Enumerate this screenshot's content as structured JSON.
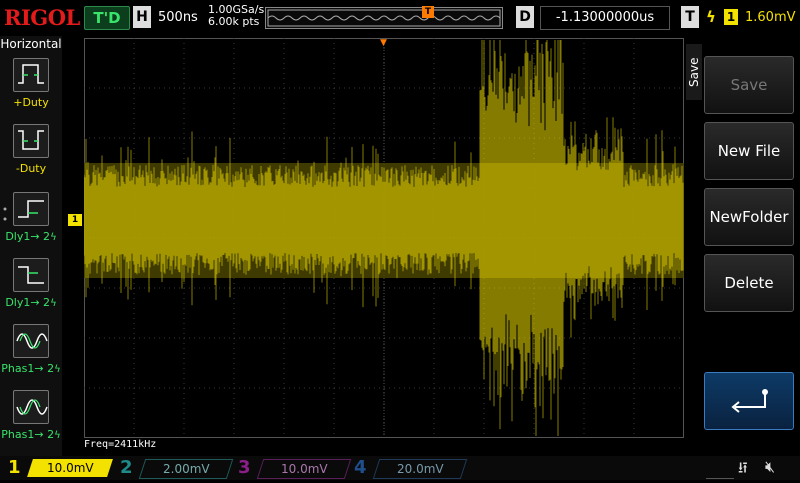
{
  "brand": "RIGOL",
  "header": {
    "run_state": "T'D",
    "horizontal_tag": "H",
    "timebase": "500ns",
    "sample_rate": "1.00GSa/s",
    "memory_depth": "6.00k pts",
    "trigger_position_marker": "T",
    "delay_tag": "D",
    "delay_value": "-1.13000000us",
    "trigger_tag": "T",
    "trigger_source": "1",
    "trigger_level": "1.60mV"
  },
  "left_menu": {
    "title": "Horizontal",
    "items": [
      {
        "label": "+Duty",
        "icon": "positive-duty-icon"
      },
      {
        "label": "-Duty",
        "icon": "negative-duty-icon"
      },
      {
        "label": "Dly1→ 2",
        "icon": "delay-rise-icon"
      },
      {
        "label": "Dly1→ 2",
        "icon": "delay-fall-icon"
      },
      {
        "label": "Phas1→ 2",
        "icon": "phase-rise-icon"
      },
      {
        "label": "Phas1→ 2",
        "icon": "phase-fall-icon"
      }
    ]
  },
  "channel_marker": "1",
  "trigger_marker": "T",
  "measurement": "Freq=2411kHz",
  "right_menu": {
    "tab": "Save",
    "buttons": [
      {
        "label": "Save",
        "enabled": false
      },
      {
        "label": "New File",
        "enabled": true
      },
      {
        "label": "NewFolder",
        "enabled": true
      },
      {
        "label": "Delete",
        "enabled": true
      },
      {
        "label": "",
        "icon": "enter-return-icon"
      }
    ]
  },
  "channels": [
    {
      "num": "1",
      "scale": "10.0mV",
      "color": "#f3e100",
      "active": true
    },
    {
      "num": "2",
      "scale": "2.00mV",
      "color": "#1f8a8a",
      "active": false
    },
    {
      "num": "3",
      "scale": "10.0mV",
      "color": "#8a1f8a",
      "active": false
    },
    {
      "num": "4",
      "scale": "20.0mV",
      "color": "#1f4f8a",
      "active": false
    }
  ],
  "colors": {
    "ch1": "#f3e100",
    "trigger": "#ff7a00",
    "grid": "#3a3a3a"
  }
}
